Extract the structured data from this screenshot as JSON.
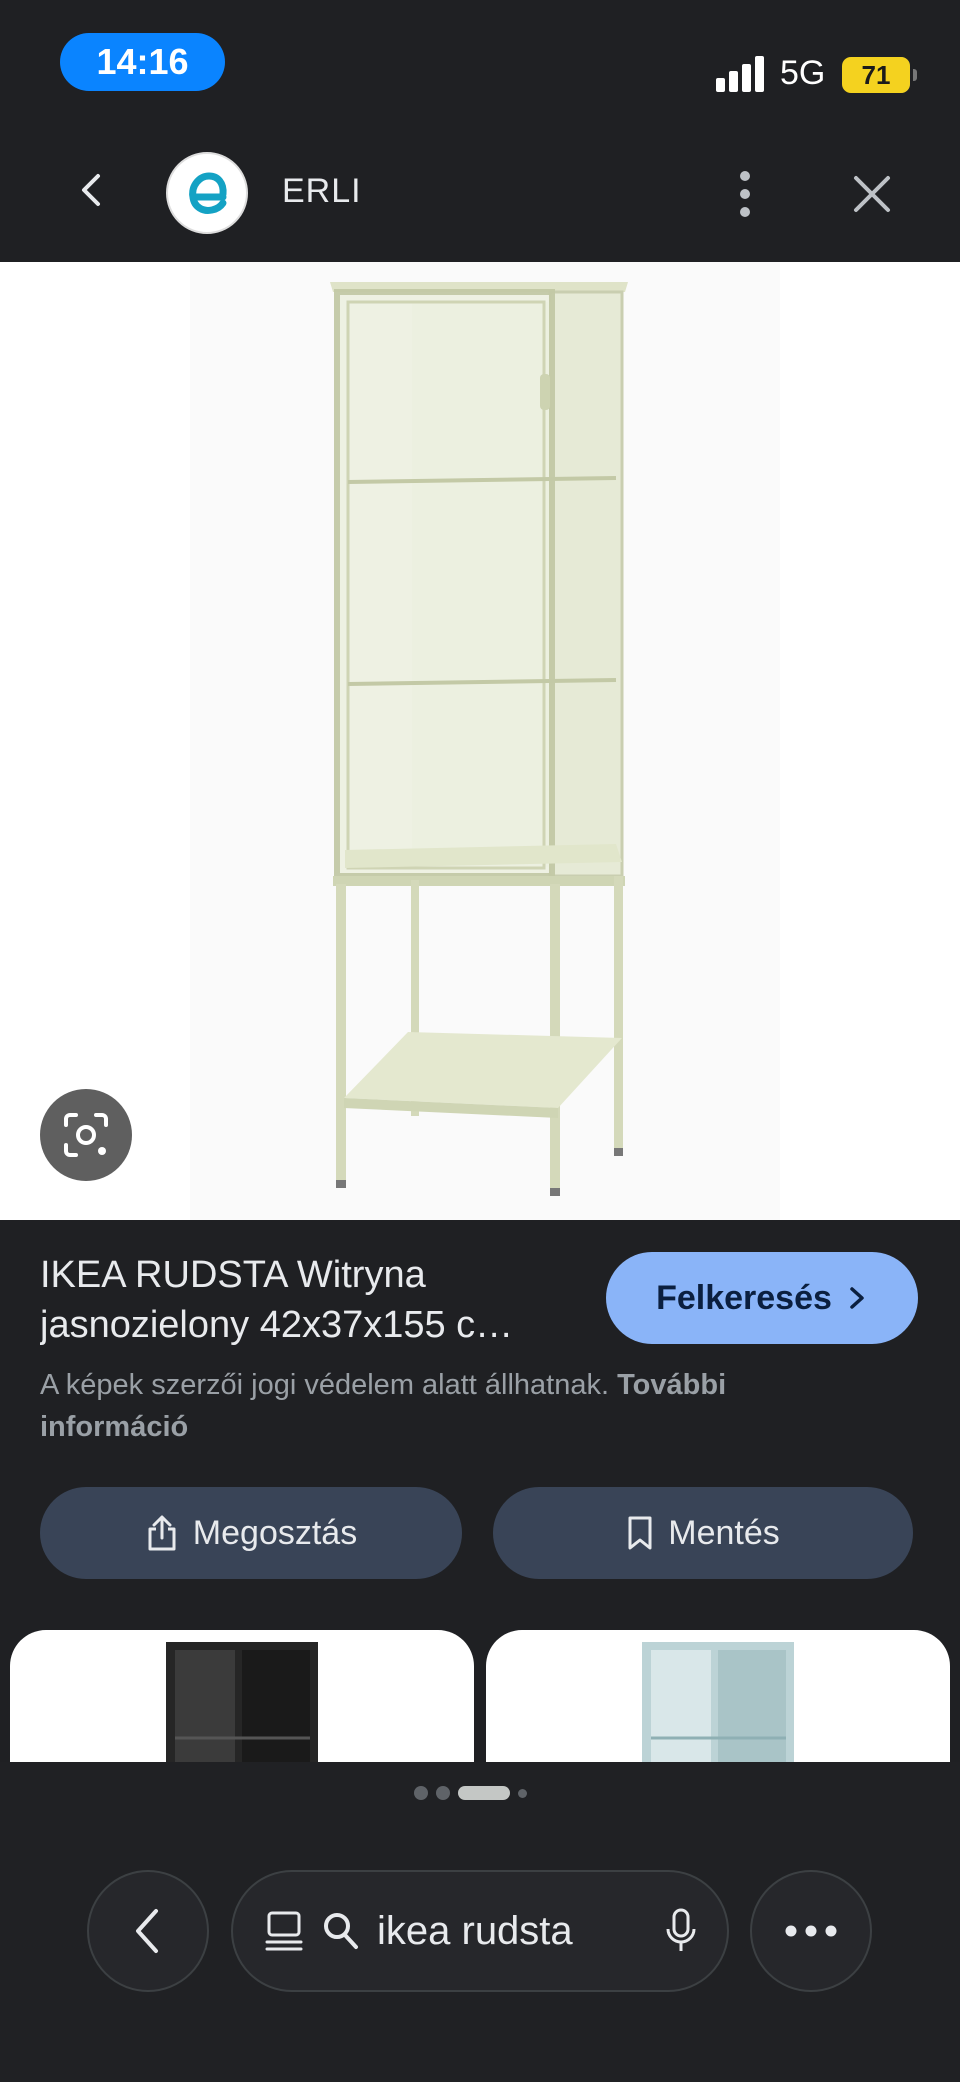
{
  "status_bar": {
    "time": "14:16",
    "network": "5G",
    "battery": "71"
  },
  "header": {
    "site_name": "ERLI",
    "back_icon": "chevron-left-icon",
    "more_icon": "vertical-dots-icon",
    "close_icon": "close-icon"
  },
  "result": {
    "title_line1": "IKEA RUDSTA Witryna",
    "title_line2": "jasnozielony 42x37x155 c…",
    "visit_label": "Felkeresés",
    "copyright_text": "A képek szerzői jogi védelem alatt állhatnak.",
    "copyright_link": "További információ"
  },
  "actions": {
    "share_label": "Megosztás",
    "save_label": "Mentés"
  },
  "pager": {
    "count": 4,
    "active_index": 2
  },
  "bottom_bar": {
    "query": "ikea rudsta"
  },
  "colors": {
    "accent": "#8ab4f8",
    "pill": "#394457",
    "background": "#1f2023",
    "time_pill": "#0a84ff",
    "battery": "#f4d21f"
  }
}
